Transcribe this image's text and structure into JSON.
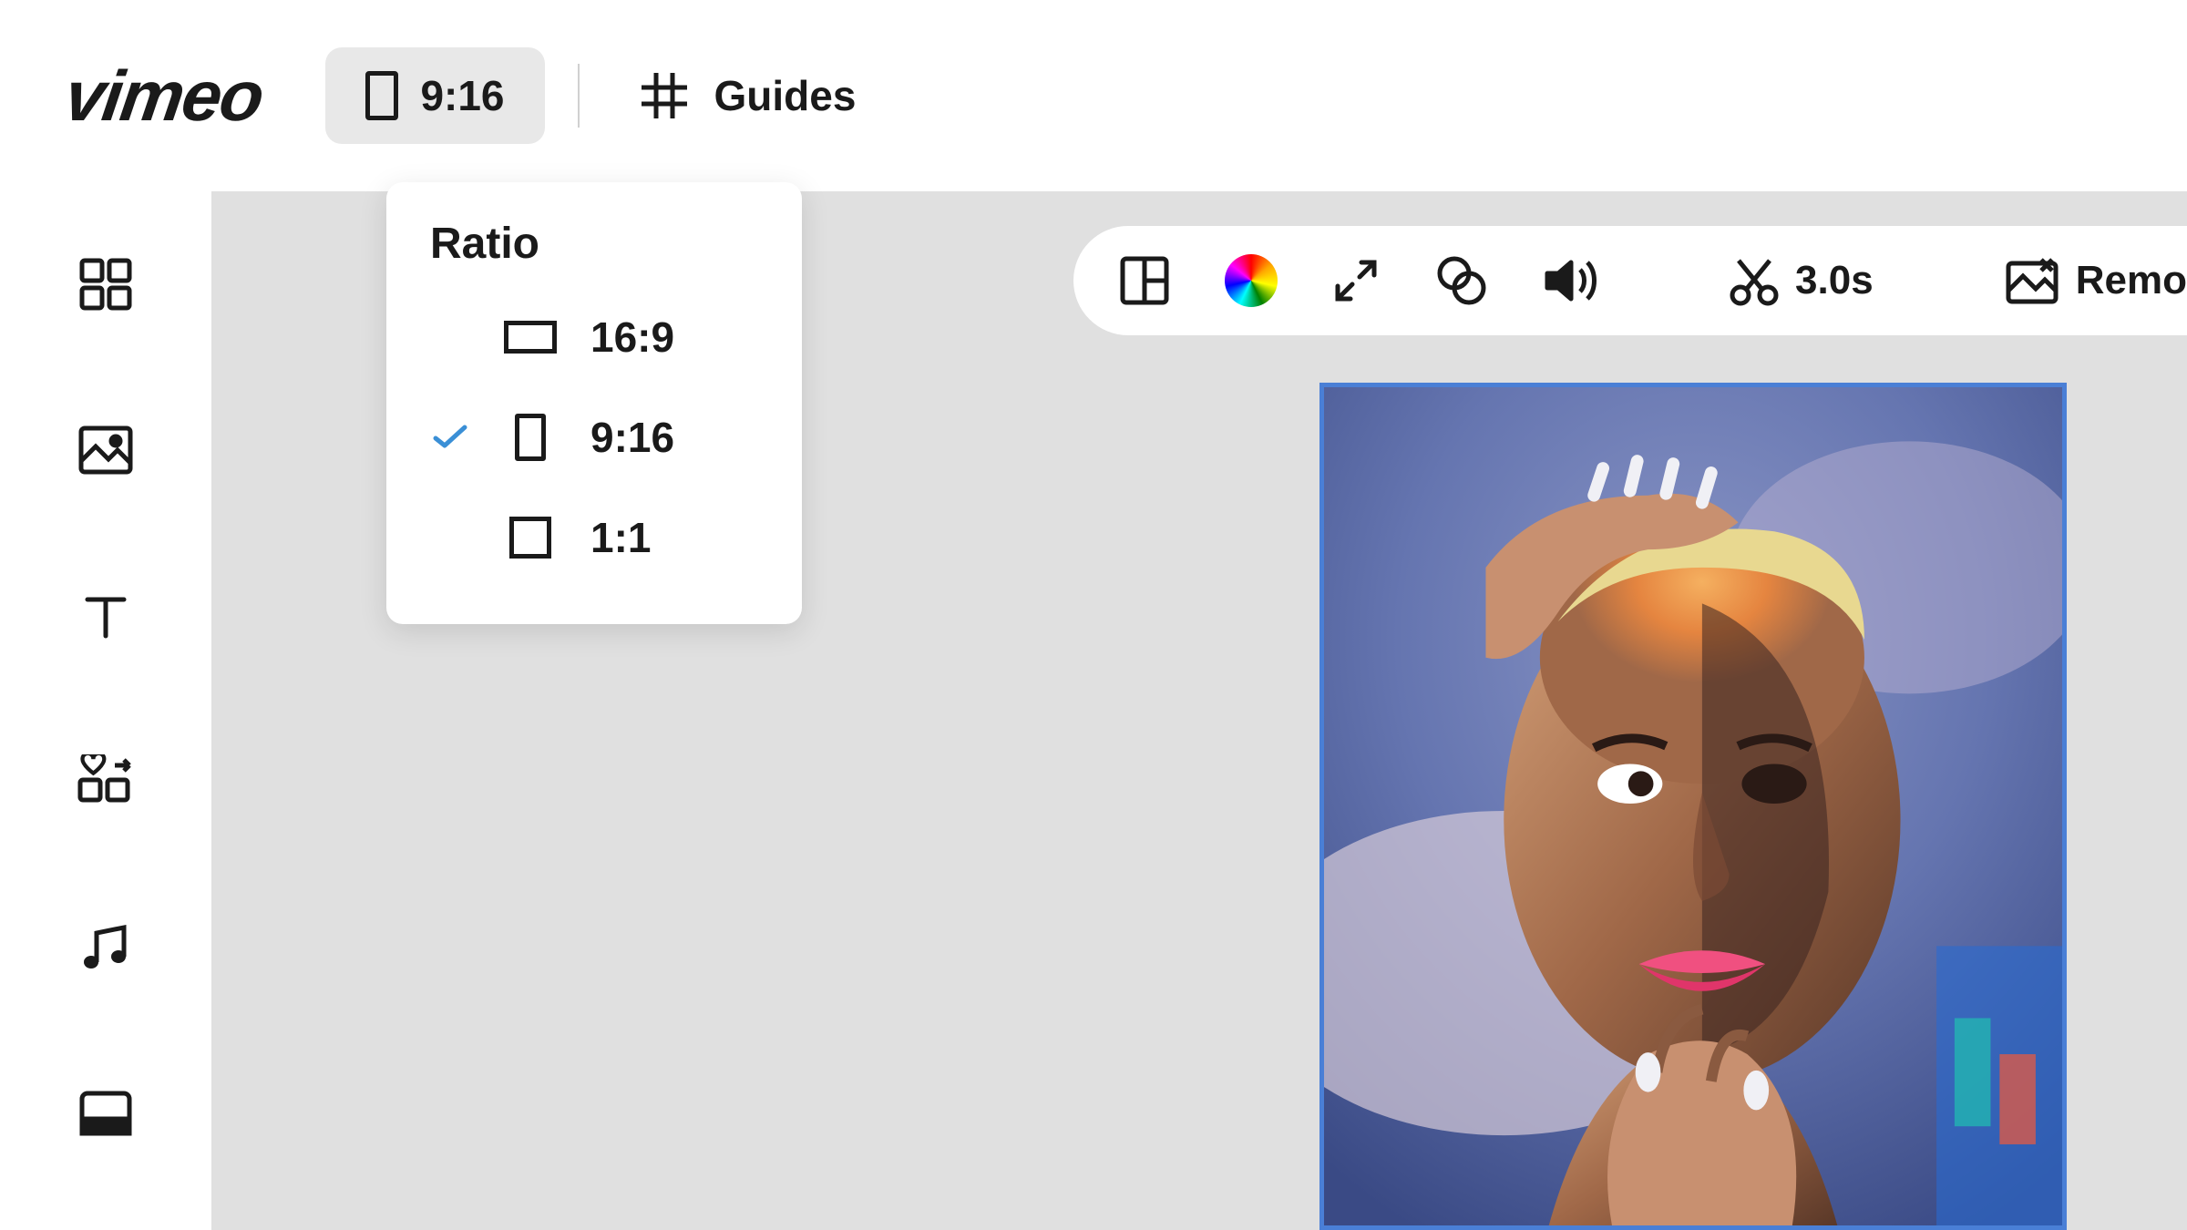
{
  "brand": "vimeo",
  "header": {
    "ratio_button_label": "9:16",
    "guides_label": "Guides"
  },
  "ratio_dropdown": {
    "title": "Ratio",
    "options": [
      {
        "label": "16:9",
        "selected": false
      },
      {
        "label": "9:16",
        "selected": true
      },
      {
        "label": "1:1",
        "selected": false
      }
    ]
  },
  "toolbar": {
    "duration_label": "3.0s",
    "remove_label": "Remo"
  }
}
